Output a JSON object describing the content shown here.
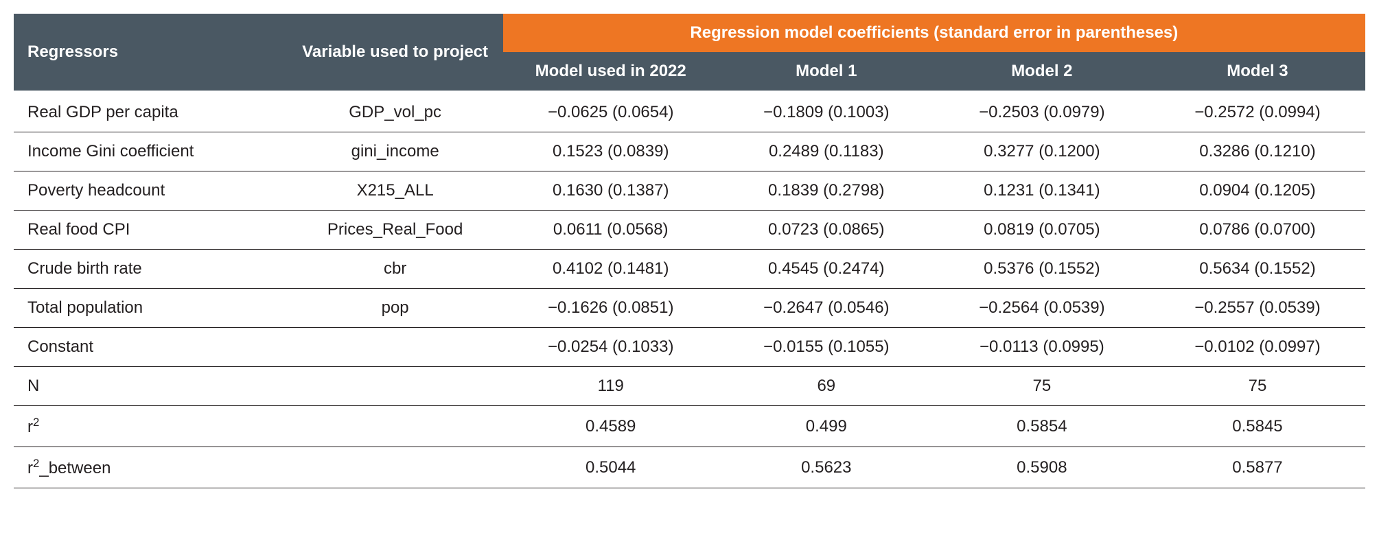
{
  "header": {
    "spanner": "Regression model coefficients (standard error in parentheses)",
    "regressors": "Regressors",
    "variable_used": "Variable used to project",
    "model_2022": "Model used in 2022",
    "model1": "Model 1",
    "model2": "Model 2",
    "model3": "Model 3"
  },
  "rows": [
    {
      "reg": "Real GDP per capita",
      "var": "GDP_vol_pc",
      "m0": "−0.0625 (0.0654)",
      "m1": "−0.1809 (0.1003)",
      "m2": "−0.2503 (0.0979)",
      "m3": "−0.2572 (0.0994)"
    },
    {
      "reg": "Income Gini coefficient",
      "var": "gini_income",
      "m0": "0.1523 (0.0839)",
      "m1": "0.2489 (0.1183)",
      "m2": "0.3277 (0.1200)",
      "m3": "0.3286 (0.1210)"
    },
    {
      "reg": "Poverty headcount",
      "var": "X215_ALL",
      "m0": "0.1630 (0.1387)",
      "m1": "0.1839 (0.2798)",
      "m2": "0.1231 (0.1341)",
      "m3": "0.0904 (0.1205)"
    },
    {
      "reg": "Real food CPI",
      "var": "Prices_Real_Food",
      "m0": "0.0611 (0.0568)",
      "m1": "0.0723 (0.0865)",
      "m2": "0.0819 (0.0705)",
      "m3": "0.0786 (0.0700)"
    },
    {
      "reg": "Crude birth rate",
      "var": "cbr",
      "m0": "0.4102 (0.1481)",
      "m1": "0.4545 (0.2474)",
      "m2": "0.5376 (0.1552)",
      "m3": "0.5634 (0.1552)"
    },
    {
      "reg": "Total population",
      "var": "pop",
      "m0": "−0.1626 (0.0851)",
      "m1": "−0.2647 (0.0546)",
      "m2": "−0.2564 (0.0539)",
      "m3": "−0.2557 (0.0539)"
    },
    {
      "reg": "Constant",
      "var": "",
      "m0": "−0.0254 (0.1033)",
      "m1": "−0.0155 (0.1055)",
      "m2": "−0.0113 (0.0995)",
      "m3": "−0.0102 (0.0997)"
    }
  ],
  "stats": {
    "n_label": "N",
    "n": {
      "m0": "119",
      "m1": "69",
      "m2": "75",
      "m3": "75"
    },
    "r2_label_pre": "r",
    "r2_label_post": "",
    "r2_sup": "2",
    "r2": {
      "m0": "0.4589",
      "m1": "0.499",
      "m2": "0.5854",
      "m3": "0.5845"
    },
    "r2b_label_pre": "r",
    "r2b_label_post": "_between",
    "r2b_sup": "2",
    "r2b": {
      "m0": "0.5044",
      "m1": "0.5623",
      "m2": "0.5908",
      "m3": "0.5877"
    }
  },
  "chart_data": {
    "type": "table",
    "title": "Regression model coefficients (standard error in parentheses)",
    "columns": [
      "Regressors",
      "Variable used to project",
      "Model used in 2022",
      "Model 1",
      "Model 2",
      "Model 3"
    ],
    "coefficients": [
      {
        "regressor": "Real GDP per capita",
        "variable": "GDP_vol_pc",
        "Model used in 2022": {
          "coef": -0.0625,
          "se": 0.0654
        },
        "Model 1": {
          "coef": -0.1809,
          "se": 0.1003
        },
        "Model 2": {
          "coef": -0.2503,
          "se": 0.0979
        },
        "Model 3": {
          "coef": -0.2572,
          "se": 0.0994
        }
      },
      {
        "regressor": "Income Gini coefficient",
        "variable": "gini_income",
        "Model used in 2022": {
          "coef": 0.1523,
          "se": 0.0839
        },
        "Model 1": {
          "coef": 0.2489,
          "se": 0.1183
        },
        "Model 2": {
          "coef": 0.3277,
          "se": 0.12
        },
        "Model 3": {
          "coef": 0.3286,
          "se": 0.121
        }
      },
      {
        "regressor": "Poverty headcount",
        "variable": "X215_ALL",
        "Model used in 2022": {
          "coef": 0.163,
          "se": 0.1387
        },
        "Model 1": {
          "coef": 0.1839,
          "se": 0.2798
        },
        "Model 2": {
          "coef": 0.1231,
          "se": 0.1341
        },
        "Model 3": {
          "coef": 0.0904,
          "se": 0.1205
        }
      },
      {
        "regressor": "Real food CPI",
        "variable": "Prices_Real_Food",
        "Model used in 2022": {
          "coef": 0.0611,
          "se": 0.0568
        },
        "Model 1": {
          "coef": 0.0723,
          "se": 0.0865
        },
        "Model 2": {
          "coef": 0.0819,
          "se": 0.0705
        },
        "Model 3": {
          "coef": 0.0786,
          "se": 0.07
        }
      },
      {
        "regressor": "Crude birth rate",
        "variable": "cbr",
        "Model used in 2022": {
          "coef": 0.4102,
          "se": 0.1481
        },
        "Model 1": {
          "coef": 0.4545,
          "se": 0.2474
        },
        "Model 2": {
          "coef": 0.5376,
          "se": 0.1552
        },
        "Model 3": {
          "coef": 0.5634,
          "se": 0.1552
        }
      },
      {
        "regressor": "Total population",
        "variable": "pop",
        "Model used in 2022": {
          "coef": -0.1626,
          "se": 0.0851
        },
        "Model 1": {
          "coef": -0.2647,
          "se": 0.0546
        },
        "Model 2": {
          "coef": -0.2564,
          "se": 0.0539
        },
        "Model 3": {
          "coef": -0.2557,
          "se": 0.0539
        }
      },
      {
        "regressor": "Constant",
        "variable": "",
        "Model used in 2022": {
          "coef": -0.0254,
          "se": 0.1033
        },
        "Model 1": {
          "coef": -0.0155,
          "se": 0.1055
        },
        "Model 2": {
          "coef": -0.0113,
          "se": 0.0995
        },
        "Model 3": {
          "coef": -0.0102,
          "se": 0.0997
        }
      }
    ],
    "fit_statistics": {
      "N": {
        "Model used in 2022": 119,
        "Model 1": 69,
        "Model 2": 75,
        "Model 3": 75
      },
      "r2": {
        "Model used in 2022": 0.4589,
        "Model 1": 0.499,
        "Model 2": 0.5854,
        "Model 3": 0.5845
      },
      "r2_between": {
        "Model used in 2022": 0.5044,
        "Model 1": 0.5623,
        "Model 2": 0.5908,
        "Model 3": 0.5877
      }
    }
  }
}
